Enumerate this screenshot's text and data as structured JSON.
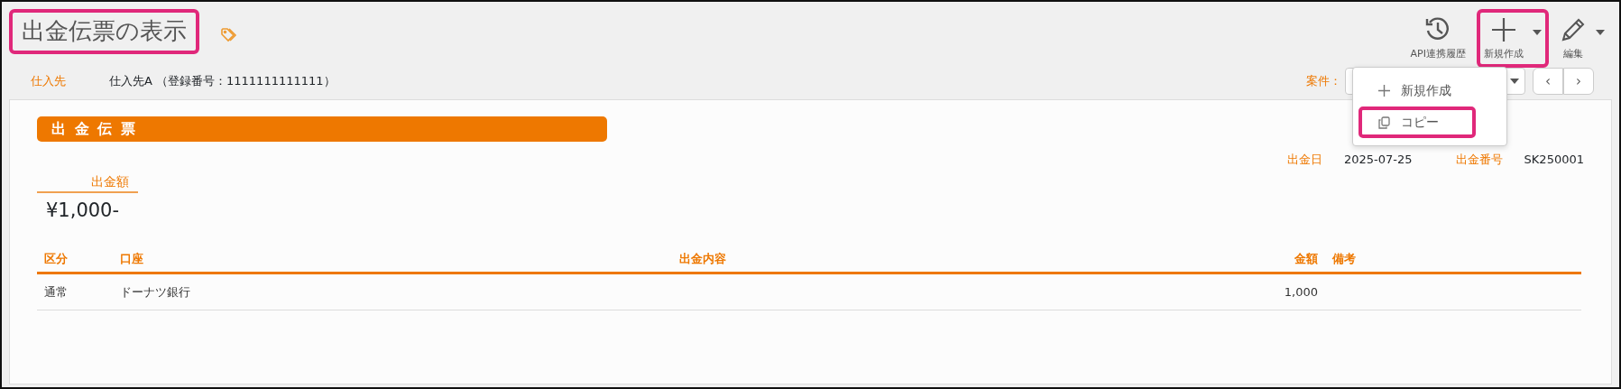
{
  "title": {
    "text": "出金伝票の表示",
    "highlighted": true
  },
  "toolbar": [
    {
      "kind": "history",
      "label": "API連携履歴",
      "dropdown": false,
      "highlighted": false
    },
    {
      "kind": "add",
      "label": "新規作成",
      "dropdown": true,
      "highlighted": true
    },
    {
      "kind": "edit",
      "label": "編集",
      "dropdown": true,
      "highlighted": false
    }
  ],
  "supplier": {
    "label": "仕入先",
    "value": "仕入先A （登録番号：1111111111111）"
  },
  "project": {
    "label": "案件："
  },
  "pager": [
    "‹",
    "›"
  ],
  "menu": [
    {
      "kind": "add",
      "label": "新規作成",
      "highlighted": false
    },
    {
      "kind": "copy",
      "label": "コピー",
      "highlighted": true
    }
  ],
  "voucher": {
    "heading": "出金伝票",
    "date_label": "出金日",
    "date": "2025-07-25",
    "number_label": "出金番号",
    "number": "SK250001",
    "amount_label": "出金額",
    "amount": "¥1,000-"
  },
  "table": {
    "columns": [
      "区分",
      "口座",
      "出金内容",
      "金額",
      "備考"
    ],
    "rows": [
      {
        "category": "通常",
        "account": "ドーナツ銀行",
        "amount": "1,000"
      }
    ]
  }
}
